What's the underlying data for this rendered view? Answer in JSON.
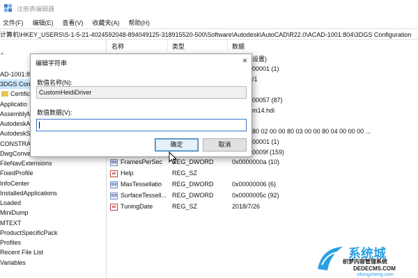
{
  "window": {
    "title": "注册表编辑器"
  },
  "menu": [
    "文件(F)",
    "编辑(E)",
    "查看(V)",
    "收藏夹(A)",
    "帮助(H)"
  ],
  "address": "计算机\\HKEY_USERS\\S-1-5-21-4024592048-894049125-318915520-500\\Software\\Autodesk\\AutoCAD\\R22.0\\ACAD-1001:804\\3DGS Configuration",
  "tree": {
    "expander": "^",
    "items": [
      {
        "label": "AD-1001:8"
      },
      {
        "label": "3DGS Conf"
      },
      {
        "label": "Certific"
      },
      {
        "label": "Applicatio"
      },
      {
        "label": "AssemblyM"
      },
      {
        "label": "AutodeskA"
      },
      {
        "label": "AutodeskS"
      },
      {
        "label": "CONSTRAI"
      },
      {
        "label": "DwgConve"
      },
      {
        "label": "FileNavExtensions"
      },
      {
        "label": "FixedProfile"
      },
      {
        "label": "InfoCenter"
      },
      {
        "label": "InstalledApplications"
      },
      {
        "label": "Loaded"
      },
      {
        "label": "MiniDump"
      },
      {
        "label": "MTEXT"
      },
      {
        "label": "ProductSpecificPack"
      },
      {
        "label": "Profiles"
      },
      {
        "label": "Recent File List"
      },
      {
        "label": "Variables"
      }
    ]
  },
  "list": {
    "headers": {
      "name": "名称",
      "type": "类型",
      "data": "数据"
    },
    "partial_data": [
      "设置)",
      "00001 (1)",
      "/1",
      "00057 (87)",
      "m14.hdi",
      "80 02 00 00 80 03 00 00 80 04 00 00 00 ...",
      "00001 (1)",
      "0009f (159)"
    ],
    "rows": [
      {
        "icon": "dword-icon",
        "name": "FramesPerSec",
        "type": "REG_DWORD",
        "data": "0x0000000a (10)"
      },
      {
        "icon": "string-icon",
        "name": "Help",
        "type": "REG_SZ",
        "data": ""
      },
      {
        "icon": "dword-icon",
        "name": "MaxTessellatio",
        "type": "REG_DWORD",
        "data": "0x00000006 (6)"
      },
      {
        "icon": "dword-icon",
        "name": "SurfaceTessell...",
        "type": "REG_DWORD",
        "data": "0x0000005c (92)"
      },
      {
        "icon": "string-icon",
        "name": "TuningDate",
        "type": "REG_SZ",
        "data": "2018/7/26"
      }
    ],
    "icon_glyphs": {
      "dword": "010",
      "string": "ab"
    }
  },
  "dialog": {
    "title": "编辑字符串",
    "close": "×",
    "name_label": "数值名称(N):",
    "name_value": "CustomHeidiDriver",
    "data_label": "数值数据(V):",
    "data_value": "",
    "ok": "确定",
    "cancel": "取消"
  },
  "watermark": {
    "brand": "系统城",
    "sub": "织梦内容管理系统",
    "url": "DEDECMS.COM",
    "url2": "xitongcheng.com"
  },
  "colors": {
    "selected_bg": "#cce8ff",
    "accent": "#3c7fb1",
    "watermark": "#2aa0e0"
  }
}
